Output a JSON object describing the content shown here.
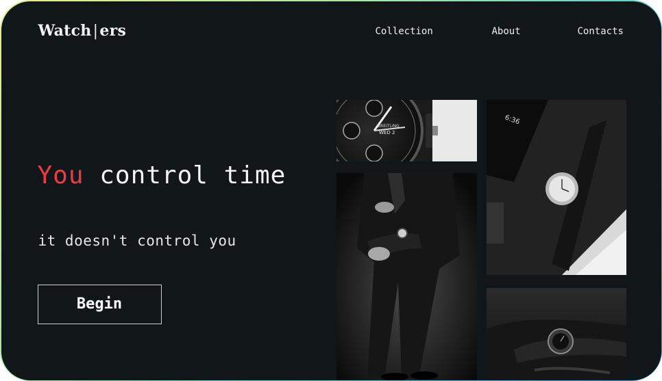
{
  "brand": {
    "logo_left": "Watch",
    "logo_sep": "|",
    "logo_right": "ers"
  },
  "nav": {
    "items": [
      {
        "label": "Collection"
      },
      {
        "label": "About"
      },
      {
        "label": "Contacts"
      }
    ]
  },
  "hero": {
    "headline_accent": "You",
    "headline_rest": "control time",
    "subline": "it doesn't control you",
    "cta_label": "Begin"
  },
  "colors": {
    "background": "#111619",
    "accent": "#ef3b45",
    "text": "#f4f4f4"
  },
  "photos": [
    {
      "subject": "chronograph watch dial close-up"
    },
    {
      "subject": "man in suit adjusting wristwatch"
    },
    {
      "subject": "leather strap watch with phone and notebook"
    },
    {
      "subject": "watch resting on dark leather surface"
    }
  ]
}
